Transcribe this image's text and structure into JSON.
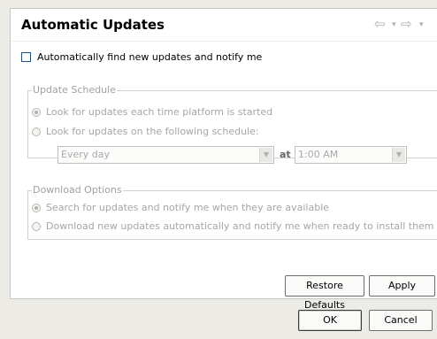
{
  "header": {
    "title": "Automatic Updates",
    "back_glyph": "⇦",
    "dropdown_glyph": "▾",
    "forward_glyph": "⇨"
  },
  "auto_find": {
    "label": "Automatically find new updates and notify me",
    "checked": false
  },
  "update_schedule": {
    "title": "Update Schedule",
    "option1": "Look for updates each time platform is started",
    "option2": "Look for updates on the following schedule:",
    "frequency_value": "Every day",
    "at_label": "at",
    "time_value": "1:00 AM"
  },
  "download_options": {
    "title": "Download Options",
    "option1": "Search for updates and notify me when they are available",
    "option2": "Download new updates automatically and notify me when ready to install them"
  },
  "buttons": {
    "restore_defaults": "Restore Defaults",
    "apply": "Apply",
    "ok": "OK",
    "cancel": "Cancel"
  },
  "colors": {
    "window_bg": "#ecebe6",
    "panel_bg": "#ffffff",
    "disabled_text": "#a6a6a6"
  }
}
